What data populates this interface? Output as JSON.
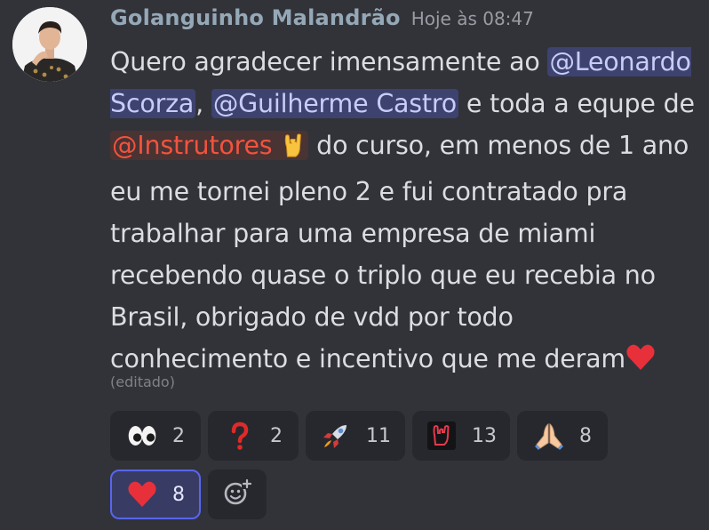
{
  "message": {
    "username": "Golanguinho Malandrão",
    "timestamp": "Hoje às 08:47",
    "text_1": "Quero agradecer imensamente ao ",
    "mention_1": "@Leonardo Scorza",
    "text_2": ", ",
    "mention_2": "@Guilherme Castro",
    "text_3": " e toda a equpe de ",
    "role_mention": "@Instrutores",
    "role_emoji": "horns-emoji",
    "text_4": " do curso, em menos de 1 ano eu me tornei pleno 2 e fui contratado pra trabalhar para uma empresa de miami recebendo quase o triplo que eu recebia no Brasil, obrigado de vdd por todo conhecimento e incentivo que me deram",
    "end_emoji": "red-heart-emoji",
    "edited_label": "(editado)"
  },
  "reactions": [
    {
      "emoji": "eyes-emoji",
      "count": "2"
    },
    {
      "emoji": "red-question-mark-emoji",
      "count": "2"
    },
    {
      "emoji": "rocket-emoji",
      "count": "11"
    },
    {
      "emoji": "horns-custom-emoji",
      "count": "13"
    },
    {
      "emoji": "folded-hands-emoji",
      "count": "8"
    },
    {
      "emoji": "red-heart-emoji",
      "count": "8",
      "active": true
    }
  ],
  "add_reaction": {
    "icon": "add-reaction-icon"
  },
  "colors": {
    "background": "#323339",
    "username": "#95a8b7",
    "mention_bg": "#3d426f",
    "mention_text": "#c8cdf7",
    "role_mention_text": "#f2533e",
    "active_reaction_border": "#5865f2"
  }
}
